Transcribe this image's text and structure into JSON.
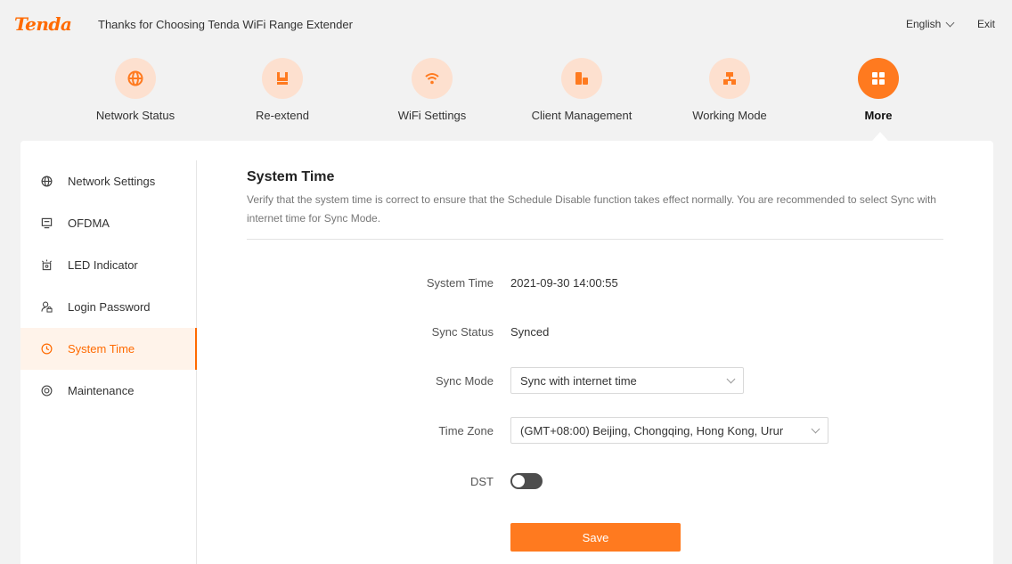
{
  "header": {
    "logo": "Tenda",
    "welcome": "Thanks for Choosing Tenda WiFi Range Extender",
    "language": "English",
    "exit": "Exit"
  },
  "nav": [
    {
      "label": "Network Status",
      "icon": "globe-icon"
    },
    {
      "label": "Re-extend",
      "icon": "plug-icon"
    },
    {
      "label": "WiFi Settings",
      "icon": "wifi-icon"
    },
    {
      "label": "Client Management",
      "icon": "devices-icon"
    },
    {
      "label": "Working Mode",
      "icon": "network-topology-icon"
    },
    {
      "label": "More",
      "icon": "grid-icon",
      "active": true
    }
  ],
  "sidebar": {
    "items": [
      {
        "label": "Network Settings",
        "icon": "globe-icon"
      },
      {
        "label": "OFDMA",
        "icon": "monitor-icon"
      },
      {
        "label": "LED Indicator",
        "icon": "lamp-icon"
      },
      {
        "label": "Login Password",
        "icon": "user-lock-icon"
      },
      {
        "label": "System Time",
        "icon": "clock-icon",
        "active": true
      },
      {
        "label": "Maintenance",
        "icon": "settings-icon"
      }
    ]
  },
  "main": {
    "title": "System Time",
    "description": "Verify that the system time is correct to ensure that the Schedule Disable function takes effect normally. You are recommended to select Sync with internet time for Sync Mode.",
    "system_time_label": "System Time",
    "system_time_value": "2021-09-30 14:00:55",
    "sync_status_label": "Sync Status",
    "sync_status_value": "Synced",
    "sync_mode_label": "Sync Mode",
    "sync_mode_value": "Sync with internet time",
    "time_zone_label": "Time Zone",
    "time_zone_value": "(GMT+08:00) Beijing, Chongqing, Hong Kong, Urur",
    "dst_label": "DST",
    "dst_enabled": false,
    "save_label": "Save"
  },
  "colors": {
    "accent": "#ff7a1f",
    "accent_light": "#fde0cf",
    "active_bg": "#fff3ea"
  }
}
